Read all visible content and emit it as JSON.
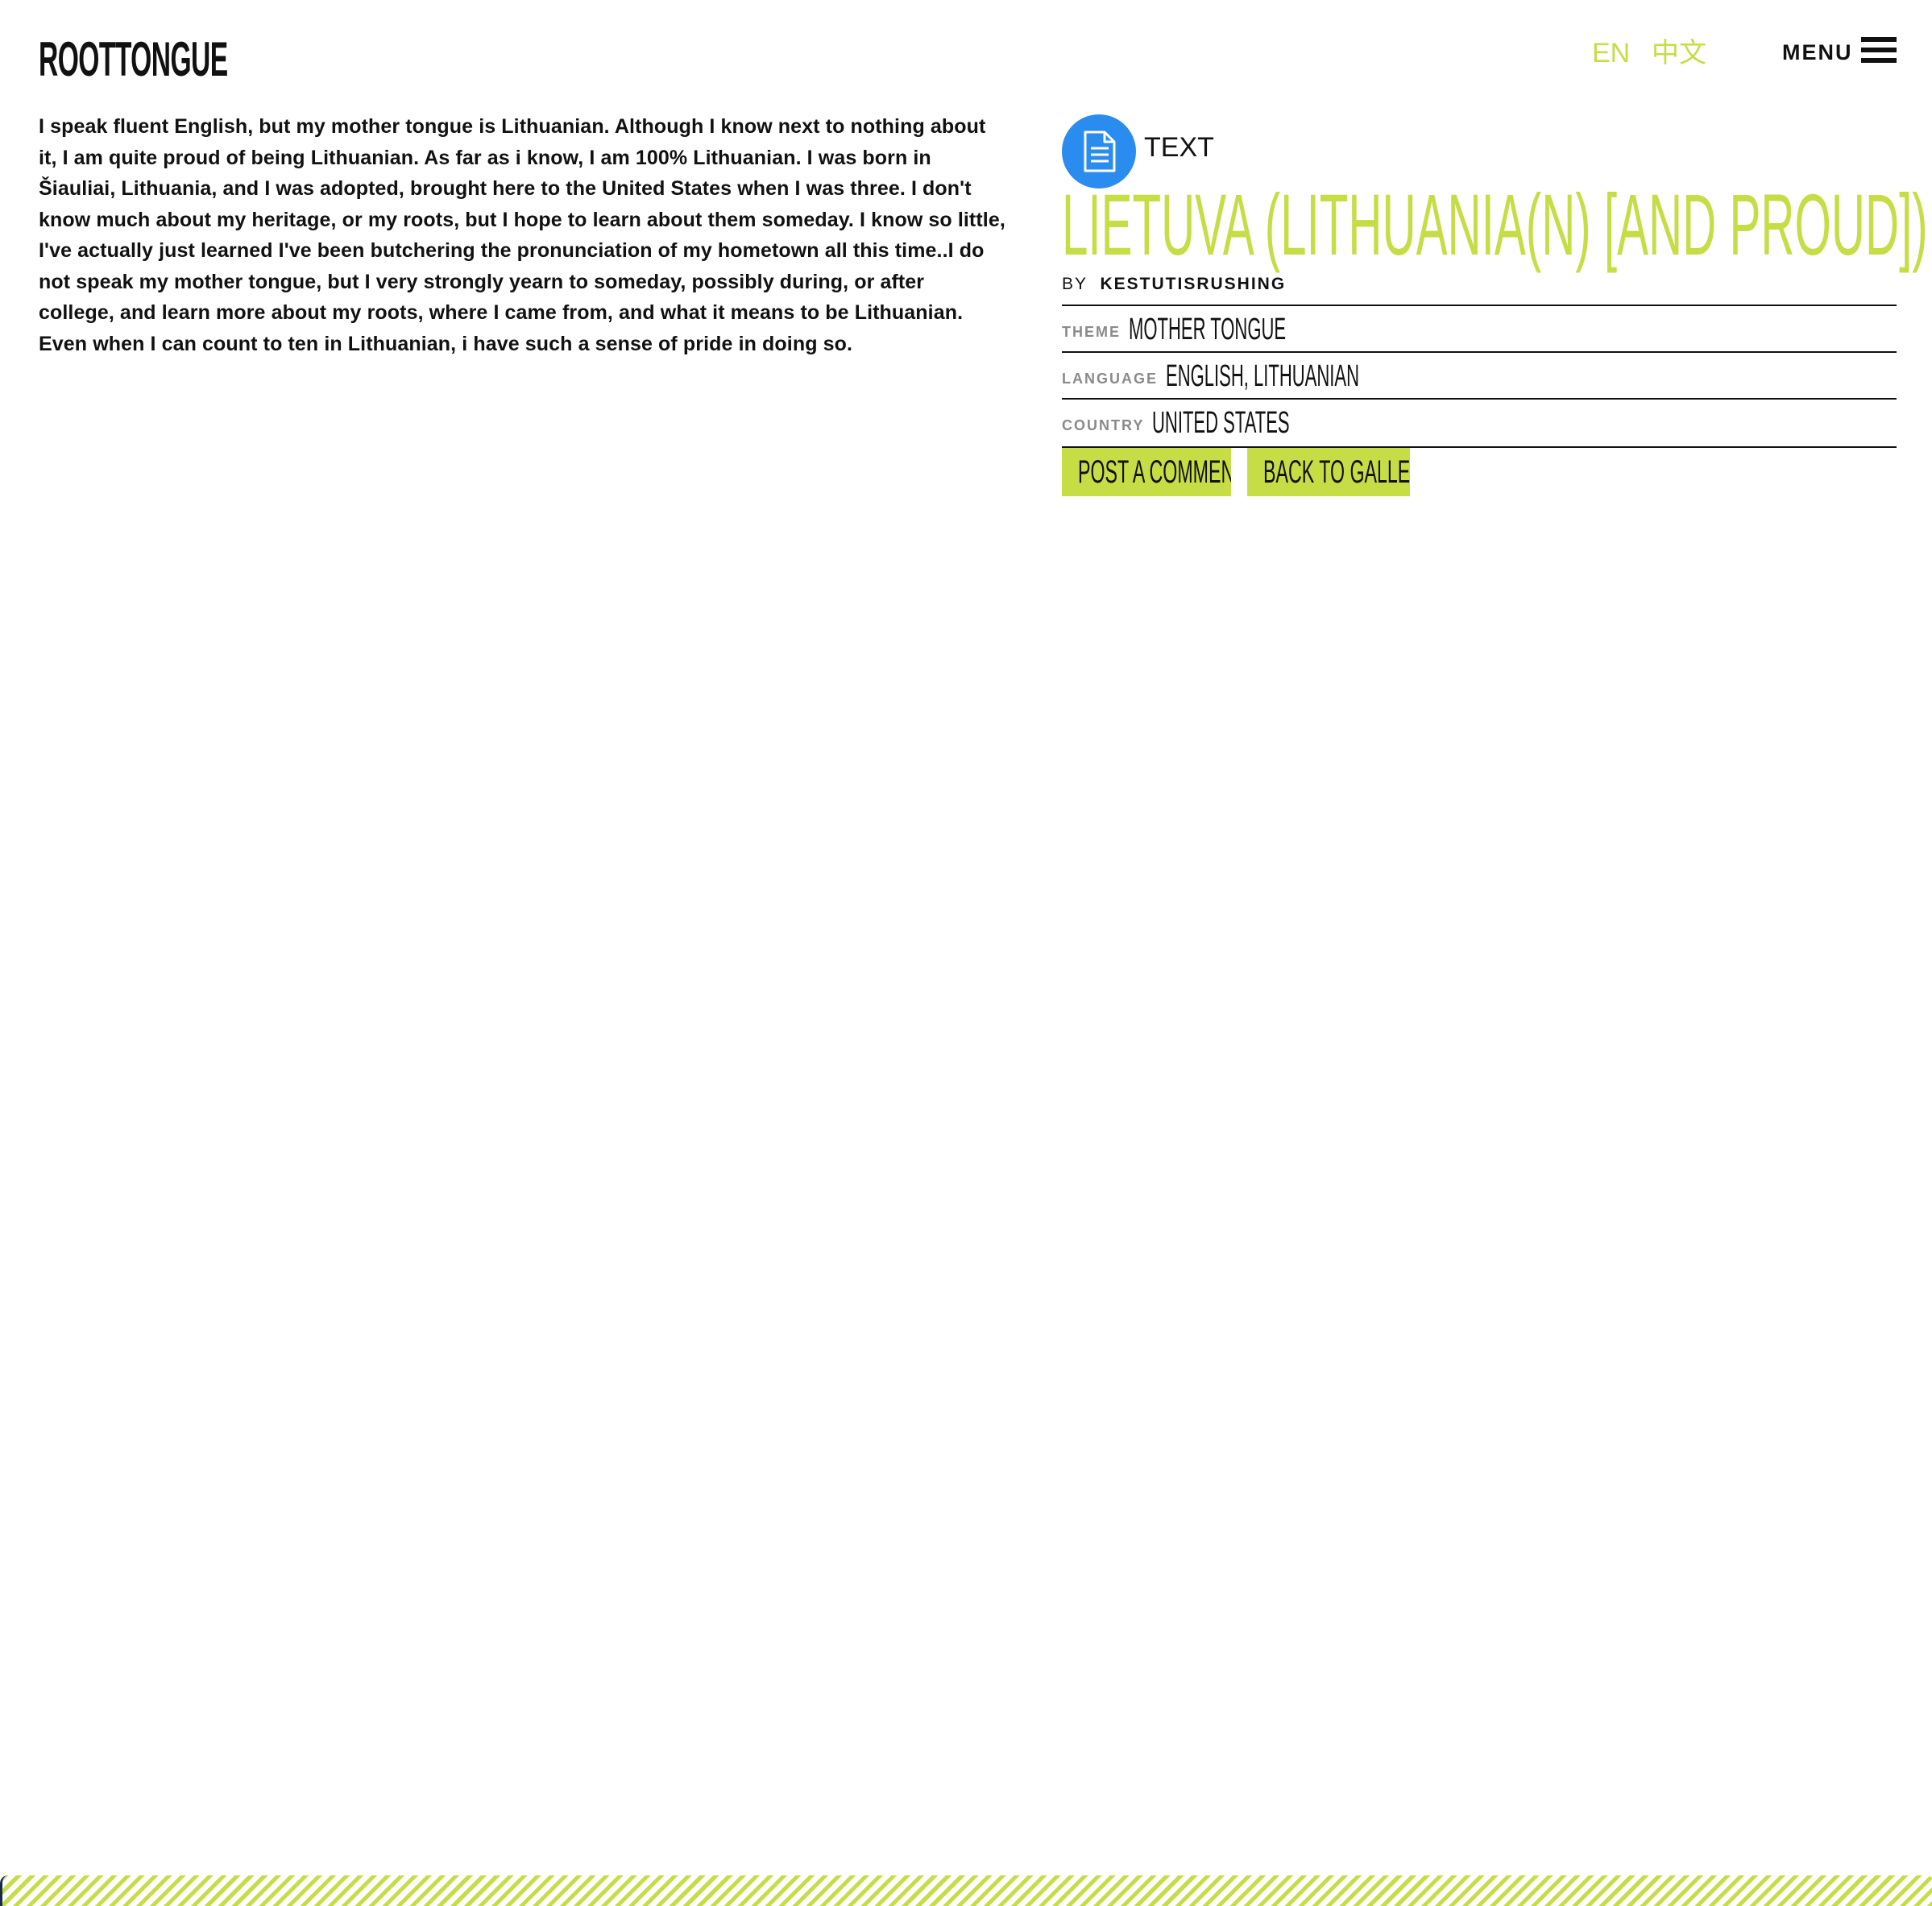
{
  "header": {
    "logo_text": "ROOTTONGUE",
    "languages": [
      "EN",
      "中文"
    ],
    "menu_label": "MENU"
  },
  "story": {
    "body": "I speak fluent English, but my mother tongue is Lithuanian. Although I know next to nothing about it, I am quite proud of being Lithuanian. As far as i know, I am 100% Lithuanian. I was born in Šiauliai, Lithuania, and I was adopted, brought here to the United States when I was three. I don't know much about my heritage, or my roots, but I hope to learn about them someday. I know so little, I've actually just learned I've been butchering the pronunciation of my hometown all this time..I do not speak my mother tongue, but I very strongly yearn to someday, possibly during, or after college, and learn more about my roots, where I came from, and what it means to be Lithuanian. Even when I can count to ten in Lithuanian, i have such a sense of pride in doing so."
  },
  "entry": {
    "type_icon": "document-icon",
    "type_label": "TEXT",
    "title": "LIETUVA (LITHUANIA(N) [AND PROUD])",
    "by_label": "BY",
    "author": "KESTUTISRUSHING",
    "meta": {
      "theme_label": "THEME",
      "theme_value": "MOTHER TONGUE",
      "language_label": "LANGUAGE",
      "language_value": "ENGLISH, LITHUANIAN",
      "country_label": "COUNTRY",
      "country_value": "UNITED STATES"
    },
    "buttons": {
      "comment": "POST A COMMENT",
      "gallery": "BACK TO GALLERY"
    }
  },
  "colors": {
    "accent": "#c6dd45",
    "icon_blue": "#2b8cf0",
    "text": "#111111",
    "muted": "#8a8a8a"
  }
}
